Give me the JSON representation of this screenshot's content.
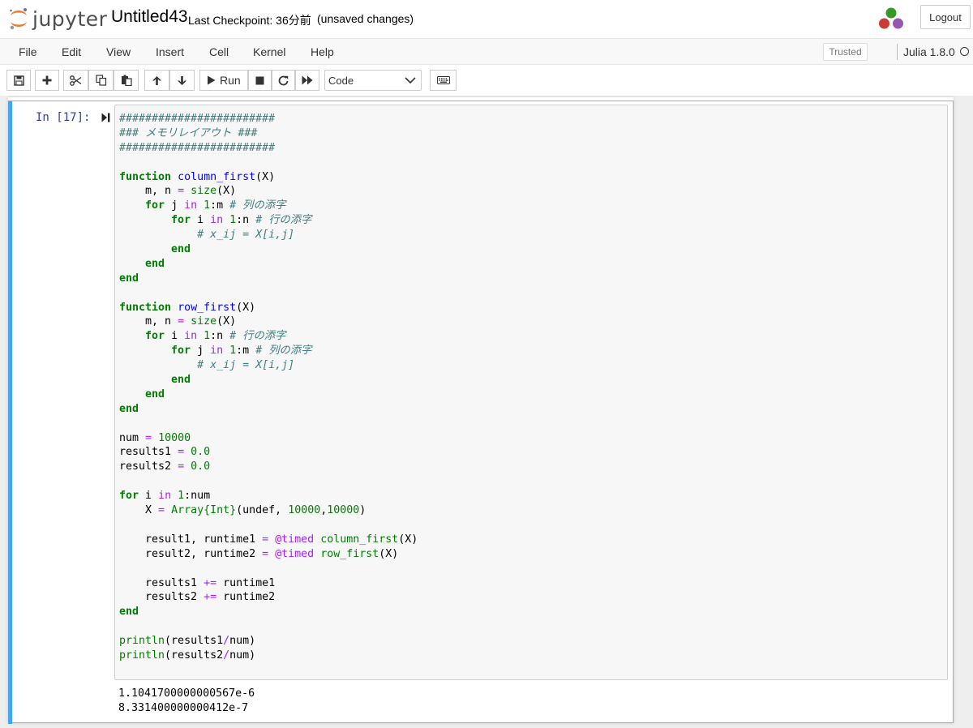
{
  "header": {
    "logo_text": "jupyter",
    "notebook_title": "Untitled43",
    "checkpoint": "Last Checkpoint: 36分前",
    "unsaved": "(unsaved changes)",
    "logout_label": "Logout"
  },
  "menubar": {
    "items": [
      "File",
      "Edit",
      "View",
      "Insert",
      "Cell",
      "Kernel",
      "Help"
    ],
    "trusted_label": "Trusted",
    "kernel_name": "Julia 1.8.0"
  },
  "toolbar": {
    "run_label": "Run",
    "cell_type": "Code",
    "icons": [
      "save-icon",
      "plus-icon",
      "cut-icon",
      "copy-icon",
      "paste-icon",
      "arrow-up-icon",
      "arrow-down-icon",
      "play-icon",
      "stop-icon",
      "restart-icon",
      "fast-forward-icon",
      "keyboard-icon"
    ]
  },
  "cell": {
    "prompt": "In [17]:",
    "code_lines": [
      [
        {
          "t": "########################",
          "c": "cm-comment"
        }
      ],
      [
        {
          "t": "### メモリレイアウト ###",
          "c": "cm-comment"
        }
      ],
      [
        {
          "t": "########################",
          "c": "cm-comment"
        }
      ],
      [],
      [
        {
          "t": "function",
          "c": "cm-kw"
        },
        {
          "t": " "
        },
        {
          "t": "column_first",
          "c": "cm-def"
        },
        {
          "t": "(X)"
        }
      ],
      [
        {
          "t": "    m, n "
        },
        {
          "t": "=",
          "c": "cm-op"
        },
        {
          "t": " "
        },
        {
          "t": "size",
          "c": "cm-builtin"
        },
        {
          "t": "(X)"
        }
      ],
      [
        {
          "t": "    "
        },
        {
          "t": "for",
          "c": "cm-kw"
        },
        {
          "t": " j "
        },
        {
          "t": "in",
          "c": "cm-op"
        },
        {
          "t": " "
        },
        {
          "t": "1",
          "c": "cm-num"
        },
        {
          "t": ":m "
        },
        {
          "t": "# 列の添字",
          "c": "cm-comment"
        }
      ],
      [
        {
          "t": "        "
        },
        {
          "t": "for",
          "c": "cm-kw"
        },
        {
          "t": " i "
        },
        {
          "t": "in",
          "c": "cm-op"
        },
        {
          "t": " "
        },
        {
          "t": "1",
          "c": "cm-num"
        },
        {
          "t": ":n "
        },
        {
          "t": "# 行の添字",
          "c": "cm-comment"
        }
      ],
      [
        {
          "t": "            "
        },
        {
          "t": "# x_ij = X[i,j]",
          "c": "cm-comment"
        }
      ],
      [
        {
          "t": "        "
        },
        {
          "t": "end",
          "c": "cm-kw"
        }
      ],
      [
        {
          "t": "    "
        },
        {
          "t": "end",
          "c": "cm-kw"
        }
      ],
      [
        {
          "t": "end",
          "c": "cm-kw"
        }
      ],
      [],
      [
        {
          "t": "function",
          "c": "cm-kw"
        },
        {
          "t": " "
        },
        {
          "t": "row_first",
          "c": "cm-def"
        },
        {
          "t": "(X)"
        }
      ],
      [
        {
          "t": "    m, n "
        },
        {
          "t": "=",
          "c": "cm-op"
        },
        {
          "t": " "
        },
        {
          "t": "size",
          "c": "cm-builtin"
        },
        {
          "t": "(X)"
        }
      ],
      [
        {
          "t": "    "
        },
        {
          "t": "for",
          "c": "cm-kw"
        },
        {
          "t": " i "
        },
        {
          "t": "in",
          "c": "cm-op"
        },
        {
          "t": " "
        },
        {
          "t": "1",
          "c": "cm-num"
        },
        {
          "t": ":n "
        },
        {
          "t": "# 行の添字",
          "c": "cm-comment"
        }
      ],
      [
        {
          "t": "        "
        },
        {
          "t": "for",
          "c": "cm-kw"
        },
        {
          "t": " j "
        },
        {
          "t": "in",
          "c": "cm-op"
        },
        {
          "t": " "
        },
        {
          "t": "1",
          "c": "cm-num"
        },
        {
          "t": ":m "
        },
        {
          "t": "# 列の添字",
          "c": "cm-comment"
        }
      ],
      [
        {
          "t": "            "
        },
        {
          "t": "# x_ij = X[i,j]",
          "c": "cm-comment"
        }
      ],
      [
        {
          "t": "        "
        },
        {
          "t": "end",
          "c": "cm-kw"
        }
      ],
      [
        {
          "t": "    "
        },
        {
          "t": "end",
          "c": "cm-kw"
        }
      ],
      [
        {
          "t": "end",
          "c": "cm-kw"
        }
      ],
      [],
      [
        {
          "t": "num "
        },
        {
          "t": "=",
          "c": "cm-op"
        },
        {
          "t": " "
        },
        {
          "t": "10000",
          "c": "cm-num"
        }
      ],
      [
        {
          "t": "results1 "
        },
        {
          "t": "=",
          "c": "cm-op"
        },
        {
          "t": " "
        },
        {
          "t": "0.0",
          "c": "cm-num"
        }
      ],
      [
        {
          "t": "results2 "
        },
        {
          "t": "=",
          "c": "cm-op"
        },
        {
          "t": " "
        },
        {
          "t": "0.0",
          "c": "cm-num"
        }
      ],
      [],
      [
        {
          "t": "for",
          "c": "cm-kw"
        },
        {
          "t": " i "
        },
        {
          "t": "in",
          "c": "cm-op"
        },
        {
          "t": " "
        },
        {
          "t": "1",
          "c": "cm-num"
        },
        {
          "t": ":num"
        }
      ],
      [
        {
          "t": "    X "
        },
        {
          "t": "=",
          "c": "cm-op"
        },
        {
          "t": " "
        },
        {
          "t": "Array{Int}",
          "c": "cm-builtin"
        },
        {
          "t": "(undef, "
        },
        {
          "t": "10000",
          "c": "cm-num"
        },
        {
          "t": ","
        },
        {
          "t": "10000",
          "c": "cm-num"
        },
        {
          "t": ")"
        }
      ],
      [],
      [
        {
          "t": "    result1, runtime1 "
        },
        {
          "t": "=",
          "c": "cm-op"
        },
        {
          "t": " "
        },
        {
          "t": "@timed",
          "c": "cm-op"
        },
        {
          "t": " "
        },
        {
          "t": "column_first",
          "c": "cm-builtin"
        },
        {
          "t": "(X)"
        }
      ],
      [
        {
          "t": "    result2, runtime2 "
        },
        {
          "t": "=",
          "c": "cm-op"
        },
        {
          "t": " "
        },
        {
          "t": "@timed",
          "c": "cm-op"
        },
        {
          "t": " "
        },
        {
          "t": "row_first",
          "c": "cm-builtin"
        },
        {
          "t": "(X)"
        }
      ],
      [],
      [
        {
          "t": "    results1 "
        },
        {
          "t": "+=",
          "c": "cm-op"
        },
        {
          "t": " runtime1"
        }
      ],
      [
        {
          "t": "    results2 "
        },
        {
          "t": "+=",
          "c": "cm-op"
        },
        {
          "t": " runtime2"
        }
      ],
      [
        {
          "t": "end",
          "c": "cm-kw"
        }
      ],
      [],
      [
        {
          "t": "println",
          "c": "cm-builtin"
        },
        {
          "t": "(results1"
        },
        {
          "t": "/",
          "c": "cm-op"
        },
        {
          "t": "num)"
        }
      ],
      [
        {
          "t": "println",
          "c": "cm-builtin"
        },
        {
          "t": "(results2"
        },
        {
          "t": "/",
          "c": "cm-op"
        },
        {
          "t": "num)"
        }
      ]
    ],
    "output_lines": [
      "1.1041700000000567e-6",
      "8.331400000000412e-7"
    ]
  },
  "colors": {
    "cell_selected_bar": "#42a5f5",
    "prompt": "#303f9f",
    "keyword": "#008000",
    "comment": "#408080",
    "definition": "#0000ff",
    "operator": "#aa22ff"
  }
}
